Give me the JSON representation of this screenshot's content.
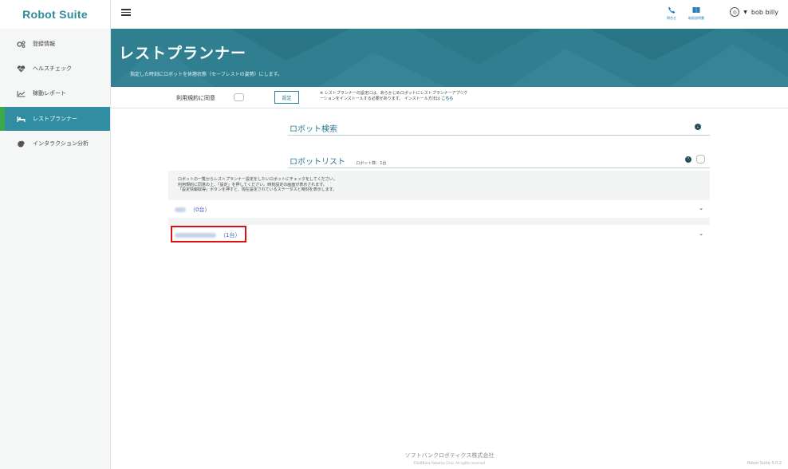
{
  "app": {
    "logo": "Robot Suite"
  },
  "sidebar": {
    "items": [
      {
        "label": "登録情報",
        "icon": "gears-icon"
      },
      {
        "label": "ヘルスチェック",
        "icon": "heart-pulse-icon"
      },
      {
        "label": "稼動レポート",
        "icon": "line-chart-icon"
      },
      {
        "label": "レストプランナー",
        "icon": "bed-icon",
        "active": true
      },
      {
        "label": "インタラクション分析",
        "icon": "pie-chart-icon"
      }
    ]
  },
  "topbar": {
    "contact_label": "問合せ",
    "manual_label": "取扱説明書",
    "user_name": "bob billy"
  },
  "banner": {
    "title": "レストプランナー",
    "subtitle": "指定した時刻にロボットを休憩状態（セーフレストの姿勢）にします。"
  },
  "consent": {
    "label": "利用規約に同意",
    "settings_button": "設定",
    "note_line1": "※ レストプランナーの設定には、あらかじめロボットにレストプランナーアプリケ",
    "note_line2": "ーションをインストールする必要があります。 インストール方法は",
    "note_link": "こちら"
  },
  "robot_search": {
    "title": "ロボット検索"
  },
  "robot_list": {
    "title": "ロボットリスト",
    "count_label": "ロボット数：1台",
    "instructions": [
      "ロボットの一覧からレストプランナー設定をしたいロボットにチェックをしてください。",
      "利用規約に同意の上、「設定」を押してください。時刻設定の画面が表示されます。",
      "「設定情報取得」ボタンを押すと、現在設定されているステータスと時刻を表示します。"
    ],
    "groups": [
      {
        "count": "（0台）"
      },
      {
        "count": "（1台）"
      }
    ]
  },
  "footer": {
    "company": "ソフトバンクロボティクス株式会社",
    "copyright": "©SoftBank Robotics Corp. All rights reserved.",
    "version": "Robot Suite 5.0.2"
  },
  "colors": {
    "accent": "#2f8b9b",
    "banner": "#2f7f90",
    "active_border": "#3aa94a",
    "highlight": "#dd1111"
  }
}
